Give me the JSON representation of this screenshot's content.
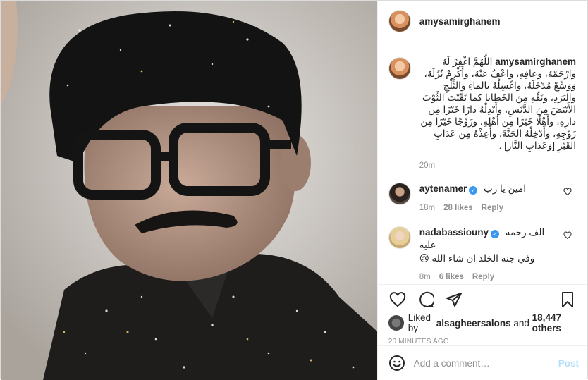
{
  "header": {
    "username": "amysamirghanem"
  },
  "caption": {
    "username": "amysamirghanem",
    "text": "اللَّهُمَّ اغْفِرْ لَهُ وارْحَمْهُ، وعافِهِ، واعْفُ عَنْهُ، وأَكْرِمْ نُزُلَهُ، وَوَسِّعْ مُدْخَلَهُ، واغْسِلْهُ بالماءِ والثَّلْجِ والبَرَدِ، ونَقِّهِ مِنَ الخَطايا كما نَقَّيْتَ الثَّوْبَ الأَبْيَضَ مِنَ الدَّنَسِ، وأَبْدِلْهُ دارًا خَيْرًا مِن دارِهِ، وأَهْلًا خَيْرًا مِن أهْلِهِ، وزَوْجًا خَيْرًا مِن زَوْجِهِ، وأَدْخِلْهُ الجَنَّةَ، وأَعِذْهُ مِن عَذابِ القَبْرِ [وَعَذابِ النَّارِ] .",
    "time": "20m"
  },
  "comments": [
    {
      "username": "aytenamer",
      "verified": true,
      "text": "امين يا رب",
      "text2": "",
      "time": "18m",
      "likes": "28 likes",
      "reply": "Reply"
    },
    {
      "username": "nadabassiouny",
      "verified": true,
      "text": "الف رحمه عليه",
      "text2": "وفي جنه الخلد ان شاء الله 😢",
      "time": "8m",
      "likes": "6 likes",
      "reply": "Reply"
    }
  ],
  "likes": {
    "prefix": "Liked by",
    "user": "alsagheersalons",
    "and": "and",
    "count": "18,447 others"
  },
  "posted_ago": "20 MINUTES AGO",
  "add_comment": {
    "placeholder": "Add a comment…",
    "post_label": "Post"
  },
  "icons": {
    "like": "heart-outline-icon",
    "comment": "comment-bubble-icon",
    "share": "paper-plane-icon",
    "save": "bookmark-icon",
    "emoji": "smiley-icon"
  },
  "colors": {
    "link_blue": "#3897f0",
    "post_disabled": "#b2dffc",
    "meta_grey": "#8e8e8e"
  }
}
